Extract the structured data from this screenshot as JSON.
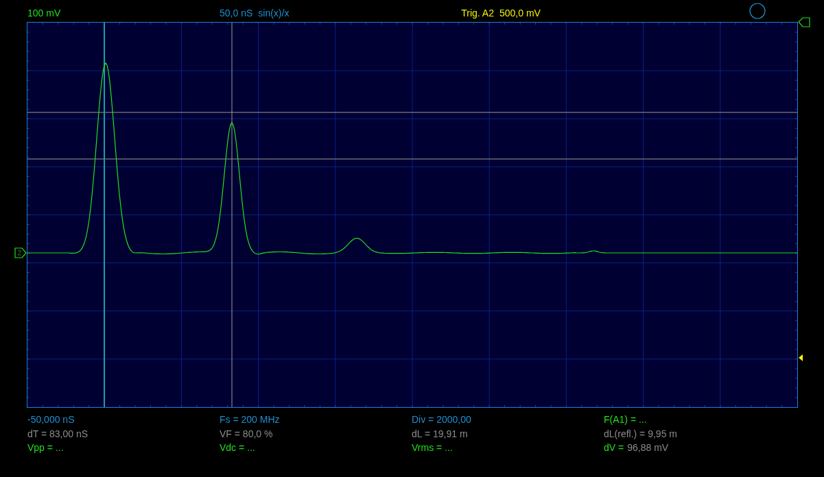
{
  "header": {
    "scale": "100 mV",
    "timebase": "50,0 nS",
    "interpolation": "sin(x)/x",
    "trigger_source": "Trig. A2",
    "trigger_level": "500,0 mV"
  },
  "readouts": [
    [
      {
        "kind": "setting",
        "text": "-50,000 nS"
      },
      {
        "kind": "cursor",
        "text": "dT = 83,00 nS"
      },
      {
        "kind": "measure",
        "text": "Vpp = ..."
      }
    ],
    [
      {
        "kind": "setting",
        "text": "Fs = 200 MHz"
      },
      {
        "kind": "cursor",
        "text": "VF = 80,0 %"
      },
      {
        "kind": "measure",
        "text": "Vdc = ..."
      }
    ],
    [
      {
        "kind": "setting",
        "text": "Div = 2000,00"
      },
      {
        "kind": "cursor",
        "text": "dL = 19,91 m"
      },
      {
        "kind": "measure",
        "text": "Vrms = ..."
      }
    ],
    [
      {
        "kind": "measure",
        "text": "F(A1) = ..."
      },
      {
        "kind": "cursor",
        "text": "dL(refl.) = 9,95 m"
      },
      {
        "kind": "split",
        "label": "dV =",
        "value": "96,88 mV"
      }
    ]
  ]
}
